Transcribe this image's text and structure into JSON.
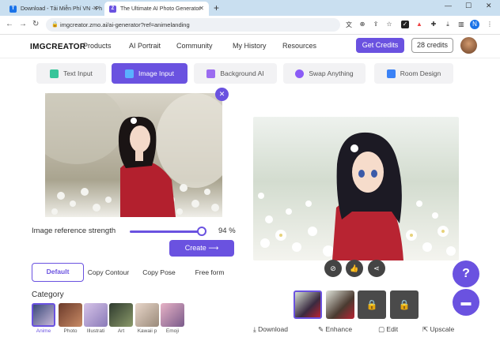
{
  "browser": {
    "tabs": [
      {
        "title": "Download - Tải Miễn Phí VN - Ph",
        "favicon": "T",
        "favicon_color": "#1a73e8"
      },
      {
        "title": "The Ultimate AI Photo Generator",
        "favicon": "Z",
        "favicon_color": "#6a52e0"
      }
    ],
    "url": "imgcreator.zmo.ai/ai-generator?ref=animelanding",
    "profile_initial": "N"
  },
  "app": {
    "logo": "IMGCREATOR",
    "nav": [
      "Products",
      "AI Portrait",
      "Community",
      "My History",
      "Resources"
    ],
    "get_credits": "Get Credits",
    "credits": "28 credits"
  },
  "modes": [
    {
      "label": "Text Input",
      "icon_color": "#37c59a"
    },
    {
      "label": "Image Input",
      "icon_color": "#5ab0ff"
    },
    {
      "label": "Background AI",
      "icon_color": "#9b6cf0"
    },
    {
      "label": "Swap Anything",
      "icon_color": "#8b5cf6"
    },
    {
      "label": "Room Design",
      "icon_color": "#3b82f6"
    }
  ],
  "controls": {
    "strength_label": "Image reference strength",
    "strength_value": 94,
    "strength_text": "94 %",
    "create_label": "Create"
  },
  "style_tabs": [
    "Default",
    "Copy Contour",
    "Copy Pose",
    "Free form"
  ],
  "category": {
    "title": "Category",
    "items": [
      "Anime",
      "Photo",
      "Illustrati",
      "Art",
      "Kawaii p",
      "Emoji"
    ]
  },
  "result_actions": [
    "Download",
    "Enhance",
    "Edit",
    "Upscale"
  ],
  "colors": {
    "accent": "#6a52e0"
  }
}
